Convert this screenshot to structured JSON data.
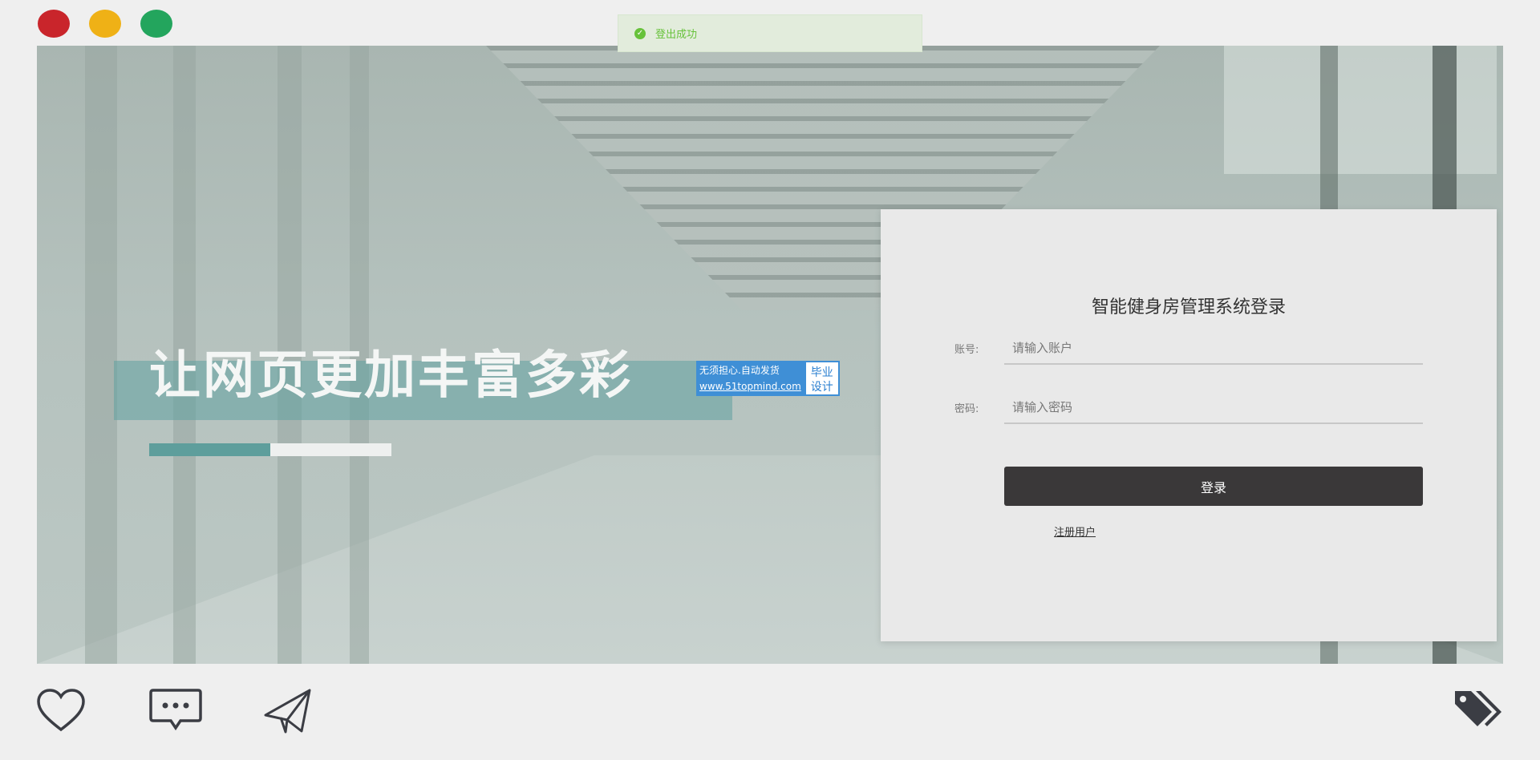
{
  "window": {
    "controls": [
      "close-dot",
      "minimize-dot",
      "maximize-dot"
    ]
  },
  "toast": {
    "message": "登出成功",
    "status_color": "#67c23a"
  },
  "hero": {
    "title": "让网页更加丰富多彩",
    "progress_fraction": 0.5
  },
  "watermark": {
    "line1": "无须担心.自动发货",
    "url": "www.51topmind.com",
    "badge_line1": "毕业",
    "badge_line2": "设计"
  },
  "login": {
    "title": "智能健身房管理系统登录",
    "account_label": "账号:",
    "account_placeholder": "请输入账户",
    "account_value": "",
    "password_label": "密码:",
    "password_placeholder": "请输入密码",
    "password_value": "",
    "submit_label": "登录",
    "register_label": "注册用户"
  },
  "bottom_icons": [
    "heart-icon",
    "chat-icon",
    "send-icon",
    "tag-icon"
  ],
  "colors": {
    "button_bg": "#3a3839",
    "accent_teal": "#5e9e9c",
    "close": "#c9252b",
    "minimize": "#efb116",
    "maximize": "#23a55d"
  }
}
